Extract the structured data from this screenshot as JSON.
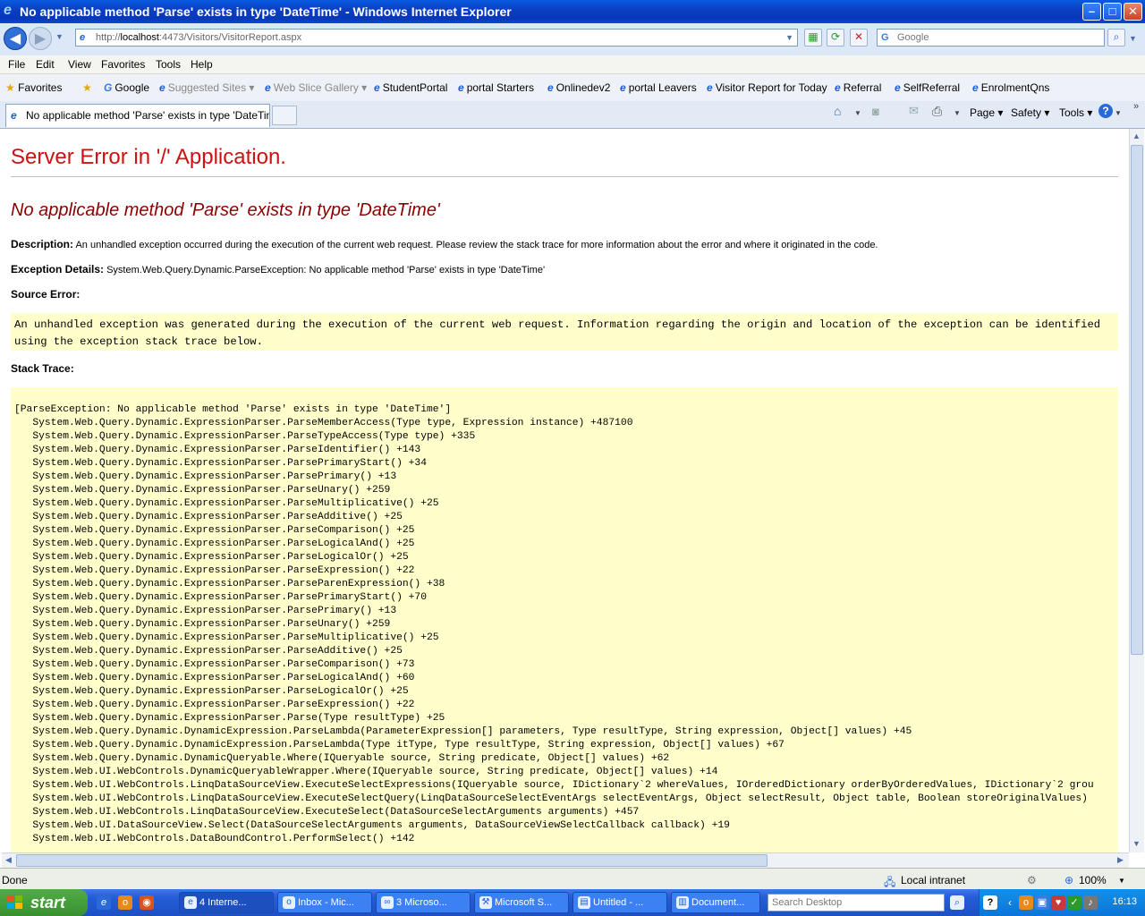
{
  "window": {
    "title": "No applicable method 'Parse' exists in type 'DateTime' - Windows Internet Explorer",
    "minimize": "–",
    "maximize": "□",
    "close": "✕"
  },
  "address": {
    "url_prefix": "http://",
    "url_host": "localhost",
    "url_rest": ":4473/Visitors/VisitorReport.aspx",
    "search_placeholder": "Google"
  },
  "menu": [
    "File",
    "Edit",
    "View",
    "Favorites",
    "Tools",
    "Help"
  ],
  "favorites": {
    "label": "Favorites",
    "items": [
      "Google",
      "Suggested Sites ▾",
      "Web Slice Gallery ▾",
      "StudentPortal",
      "portal Starters",
      "Onlinedev2",
      "portal Leavers",
      "Visitor Report for Today",
      "Referral",
      "SelfReferral",
      "EnrolmentQns"
    ]
  },
  "tab": {
    "label": "No applicable method 'Parse' exists in type 'DateTime'"
  },
  "commandbar": {
    "page": "Page ▾",
    "safety": "Safety ▾",
    "tools": "Tools ▾"
  },
  "page": {
    "heading": "Server Error in '/' Application.",
    "subheading": "No applicable method 'Parse' exists in type 'DateTime'",
    "description_label": "Description:",
    "description": "An unhandled exception occurred during the execution of the current web request. Please review the stack trace for more information about the error and where it originated in the code.",
    "exception_label": "Exception Details:",
    "exception": "System.Web.Query.Dynamic.ParseException: No applicable method 'Parse' exists in type 'DateTime'",
    "source_label": "Source Error:",
    "source": "An unhandled exception was generated during the execution of the current web request. Information regarding the origin and location of the exception can be identified using the exception stack trace below.",
    "stack_label": "Stack Trace:",
    "stack": "[ParseException: No applicable method 'Parse' exists in type 'DateTime']\n   System.Web.Query.Dynamic.ExpressionParser.ParseMemberAccess(Type type, Expression instance) +487100\n   System.Web.Query.Dynamic.ExpressionParser.ParseTypeAccess(Type type) +335\n   System.Web.Query.Dynamic.ExpressionParser.ParseIdentifier() +143\n   System.Web.Query.Dynamic.ExpressionParser.ParsePrimaryStart() +34\n   System.Web.Query.Dynamic.ExpressionParser.ParsePrimary() +13\n   System.Web.Query.Dynamic.ExpressionParser.ParseUnary() +259\n   System.Web.Query.Dynamic.ExpressionParser.ParseMultiplicative() +25\n   System.Web.Query.Dynamic.ExpressionParser.ParseAdditive() +25\n   System.Web.Query.Dynamic.ExpressionParser.ParseComparison() +25\n   System.Web.Query.Dynamic.ExpressionParser.ParseLogicalAnd() +25\n   System.Web.Query.Dynamic.ExpressionParser.ParseLogicalOr() +25\n   System.Web.Query.Dynamic.ExpressionParser.ParseExpression() +22\n   System.Web.Query.Dynamic.ExpressionParser.ParseParenExpression() +38\n   System.Web.Query.Dynamic.ExpressionParser.ParsePrimaryStart() +70\n   System.Web.Query.Dynamic.ExpressionParser.ParsePrimary() +13\n   System.Web.Query.Dynamic.ExpressionParser.ParseUnary() +259\n   System.Web.Query.Dynamic.ExpressionParser.ParseMultiplicative() +25\n   System.Web.Query.Dynamic.ExpressionParser.ParseAdditive() +25\n   System.Web.Query.Dynamic.ExpressionParser.ParseComparison() +73\n   System.Web.Query.Dynamic.ExpressionParser.ParseLogicalAnd() +60\n   System.Web.Query.Dynamic.ExpressionParser.ParseLogicalOr() +25\n   System.Web.Query.Dynamic.ExpressionParser.ParseExpression() +22\n   System.Web.Query.Dynamic.ExpressionParser.Parse(Type resultType) +25\n   System.Web.Query.Dynamic.DynamicExpression.ParseLambda(ParameterExpression[] parameters, Type resultType, String expression, Object[] values) +45\n   System.Web.Query.Dynamic.DynamicExpression.ParseLambda(Type itType, Type resultType, String expression, Object[] values) +67\n   System.Web.Query.Dynamic.DynamicQueryable.Where(IQueryable source, String predicate, Object[] values) +62\n   System.Web.UI.WebControls.DynamicQueryableWrapper.Where(IQueryable source, String predicate, Object[] values) +14\n   System.Web.UI.WebControls.LinqDataSourceView.ExecuteSelectExpressions(IQueryable source, IDictionary`2 whereValues, IOrderedDictionary orderByOrderedValues, IDictionary`2 grou\n   System.Web.UI.WebControls.LinqDataSourceView.ExecuteSelectQuery(LinqDataSourceSelectEventArgs selectEventArgs, Object selectResult, Object table, Boolean storeOriginalValues)\n   System.Web.UI.WebControls.LinqDataSourceView.ExecuteSelect(DataSourceSelectArguments arguments) +457\n   System.Web.UI.DataSourceView.Select(DataSourceSelectArguments arguments, DataSourceViewSelectCallback callback) +19\n   System.Web.UI.WebControls.DataBoundControl.PerformSelect() +142"
  },
  "status": {
    "text": "Done",
    "zone": "Local intranet",
    "zoom": "100%"
  },
  "taskbar": {
    "start": "start",
    "buttons": [
      "4 Interne...",
      "Inbox - Mic...",
      "3 Microso...",
      "Microsoft S...",
      "Untitled - ...",
      "Document..."
    ],
    "search_placeholder": "Search Desktop",
    "clock": "16:13"
  },
  "colors": {
    "error_red": "#d01010",
    "subheading": "#8b0000",
    "code_bg": "#ffffcc",
    "taskbar": "#245dd6"
  }
}
